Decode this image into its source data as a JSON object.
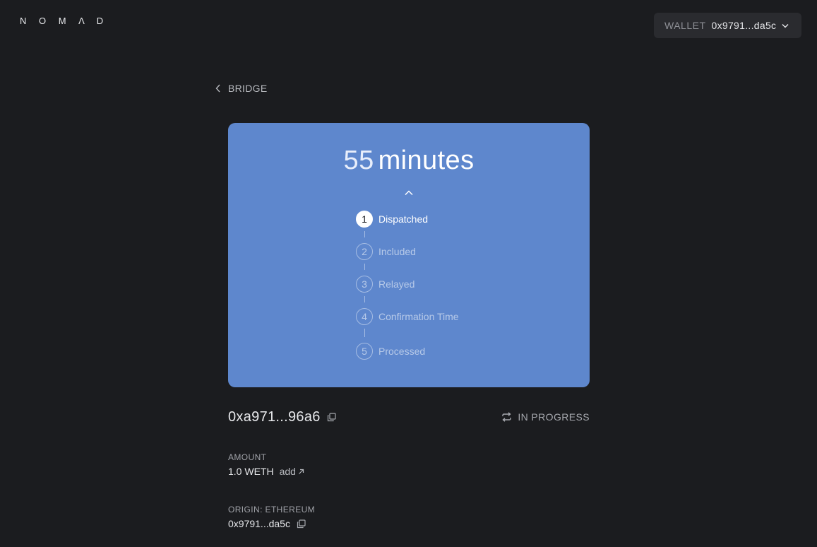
{
  "header": {
    "logo": "N O M Λ D",
    "wallet": {
      "label": "WALLET",
      "address": "0x9791...da5c",
      "chevron_icon": "chevron-down-icon"
    }
  },
  "nav": {
    "back_label": "BRIDGE",
    "back_icon": "chevron-left-icon"
  },
  "status_card": {
    "bg_color": "#5e87cd",
    "time_value": "55",
    "time_unit": "minutes",
    "collapse_icon": "chevron-up-icon",
    "steps": [
      {
        "number": "1",
        "label": "Dispatched",
        "active": true
      },
      {
        "number": "2",
        "label": "Included",
        "active": false
      },
      {
        "number": "3",
        "label": "Relayed",
        "active": false
      },
      {
        "number": "4",
        "label": "Confirmation Time",
        "active": false
      },
      {
        "number": "5",
        "label": "Processed",
        "active": false
      }
    ]
  },
  "transaction": {
    "hash": "0xa971...96a6",
    "copy_icon": "copy-icon",
    "status": "IN PROGRESS",
    "status_icon": "sync-icon"
  },
  "details": {
    "amount_label": "AMOUNT",
    "amount_value": "1.0 WETH",
    "add_link": "add",
    "add_icon": "external-link-icon",
    "origin_label": "ORIGIN: ETHEREUM",
    "origin_address": "0x9791...da5c"
  },
  "colors": {
    "background": "#1b1c1f",
    "card": "#5e87cd",
    "wallet_bg": "#2a2b2f"
  }
}
